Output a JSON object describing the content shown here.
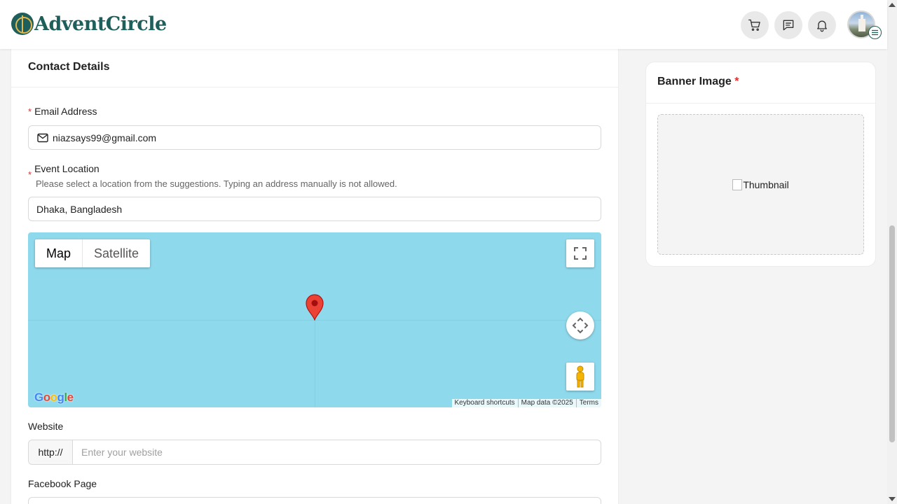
{
  "header": {
    "brand": "AdventCircle",
    "actions": [
      "cart-icon",
      "chat-icon",
      "bell-icon"
    ]
  },
  "contact": {
    "title": "Contact Details",
    "email_label": "Email Address",
    "email_value": "niazsays99@gmail.com",
    "location_label": "Event Location",
    "location_hint": "Please select a location from the suggestions. Typing an address manually is not allowed.",
    "location_value": "Dhaka, Bangladesh",
    "map": {
      "type_map": "Map",
      "type_satellite": "Satellite",
      "google": "Google",
      "attr_shortcuts": "Keyboard shortcuts",
      "attr_data": "Map data ©2025",
      "attr_terms": "Terms"
    },
    "website_label": "Website",
    "website_prefix": "http://",
    "website_placeholder": "Enter your website",
    "facebook_label": "Facebook Page"
  },
  "banner": {
    "title": "Banner Image",
    "required_mark": "*",
    "thumbnail_alt": "Thumbnail"
  },
  "colors": {
    "brand": "#1f5f5b",
    "required": "#e03131",
    "map_water": "#8fd9ec"
  }
}
